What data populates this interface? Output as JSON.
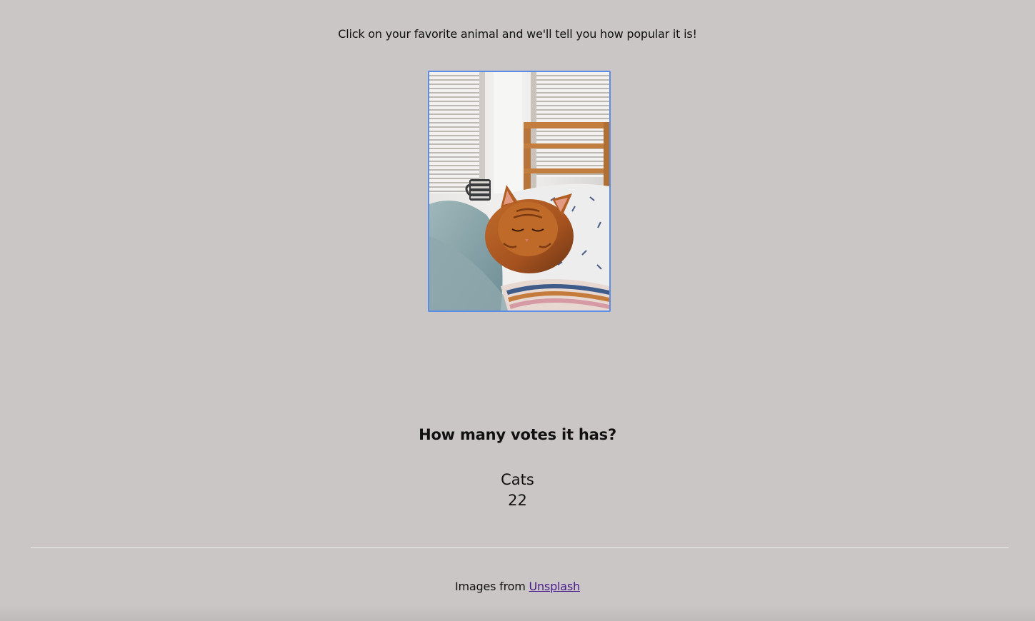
{
  "header": {
    "intro_text": "Click on your favorite animal and we'll tell you how popular it is!"
  },
  "gallery": {
    "image_alt": "Cats"
  },
  "results": {
    "heading": "How many votes it has?",
    "animal_name": "Cats",
    "vote_count": "22"
  },
  "footer": {
    "prefix": "Images from",
    "link_text": "Unsplash"
  },
  "colors": {
    "background": "#c9c6c5",
    "card_focus_border": "#5b8de6",
    "link": "#4a1a8c",
    "divider": "#eeeeee"
  }
}
